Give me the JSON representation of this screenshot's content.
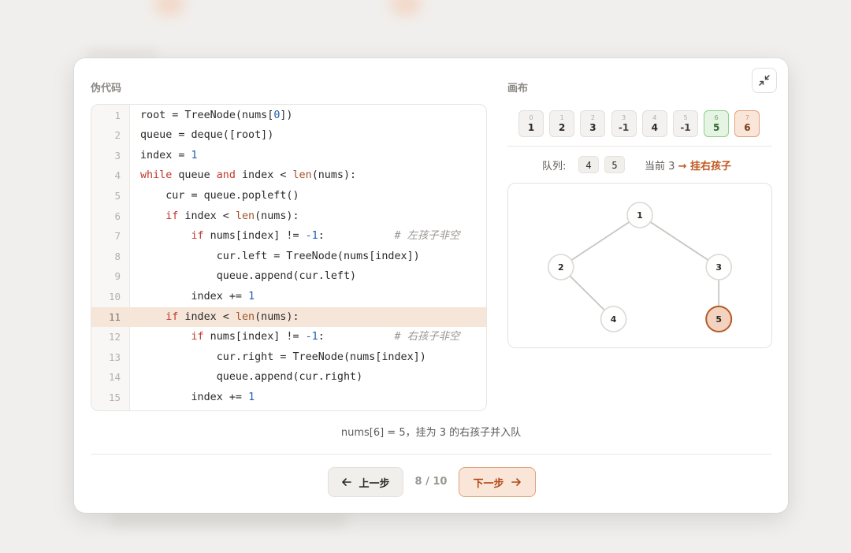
{
  "pseudocode_title": "伪代码",
  "canvas_title": "画布",
  "code": {
    "active_line": 11,
    "lines": [
      {
        "n": "1",
        "tokens": [
          {
            "t": "root = TreeNode(nums["
          },
          {
            "t": "0",
            "c": "num"
          },
          {
            "t": "])"
          }
        ]
      },
      {
        "n": "2",
        "tokens": [
          {
            "t": "queue = deque([root])"
          }
        ]
      },
      {
        "n": "3",
        "tokens": [
          {
            "t": "index = "
          },
          {
            "t": "1",
            "c": "num"
          }
        ]
      },
      {
        "n": "4",
        "tokens": [
          {
            "t": "while",
            "c": "kw"
          },
          {
            "t": " queue "
          },
          {
            "t": "and",
            "c": "kw"
          },
          {
            "t": " index < "
          },
          {
            "t": "len",
            "c": "bi"
          },
          {
            "t": "(nums):"
          }
        ]
      },
      {
        "n": "5",
        "tokens": [
          {
            "t": "    cur = queue.popleft()"
          }
        ]
      },
      {
        "n": "6",
        "tokens": [
          {
            "t": "    "
          },
          {
            "t": "if",
            "c": "kw"
          },
          {
            "t": " index < "
          },
          {
            "t": "len",
            "c": "bi"
          },
          {
            "t": "(nums):"
          }
        ]
      },
      {
        "n": "7",
        "tokens": [
          {
            "t": "        "
          },
          {
            "t": "if",
            "c": "kw"
          },
          {
            "t": " nums[index] != "
          },
          {
            "t": "-1",
            "c": "num"
          },
          {
            "t": ":           "
          },
          {
            "t": "# 左孩子非空",
            "c": "cm"
          }
        ]
      },
      {
        "n": "8",
        "tokens": [
          {
            "t": "            cur.left = TreeNode(nums[index])"
          }
        ]
      },
      {
        "n": "9",
        "tokens": [
          {
            "t": "            queue.append(cur.left)"
          }
        ]
      },
      {
        "n": "10",
        "tokens": [
          {
            "t": "        index += "
          },
          {
            "t": "1",
            "c": "num"
          }
        ]
      },
      {
        "n": "11",
        "tokens": [
          {
            "t": "    "
          },
          {
            "t": "if",
            "c": "kw"
          },
          {
            "t": " index < "
          },
          {
            "t": "len",
            "c": "bi"
          },
          {
            "t": "(nums):"
          }
        ]
      },
      {
        "n": "12",
        "tokens": [
          {
            "t": "        "
          },
          {
            "t": "if",
            "c": "kw"
          },
          {
            "t": " nums[index] != "
          },
          {
            "t": "-1",
            "c": "num"
          },
          {
            "t": ":           "
          },
          {
            "t": "# 右孩子非空",
            "c": "cm"
          }
        ]
      },
      {
        "n": "13",
        "tokens": [
          {
            "t": "            cur.right = TreeNode(nums[index])"
          }
        ]
      },
      {
        "n": "14",
        "tokens": [
          {
            "t": "            queue.append(cur.right)"
          }
        ]
      },
      {
        "n": "15",
        "tokens": [
          {
            "t": "        index += "
          },
          {
            "t": "1",
            "c": "num"
          }
        ]
      }
    ]
  },
  "array": [
    {
      "idx": "0",
      "val": "1",
      "state": "done"
    },
    {
      "idx": "1",
      "val": "2",
      "state": "done"
    },
    {
      "idx": "2",
      "val": "3",
      "state": "done"
    },
    {
      "idx": "3",
      "val": "-1",
      "state": "faded"
    },
    {
      "idx": "4",
      "val": "4",
      "state": "done"
    },
    {
      "idx": "5",
      "val": "-1",
      "state": "faded"
    },
    {
      "idx": "6",
      "val": "5",
      "state": "green"
    },
    {
      "idx": "7",
      "val": "6",
      "state": "orange"
    }
  ],
  "queue": {
    "label": "队列:",
    "items": [
      "4",
      "5"
    ],
    "current_label": "当前",
    "current_value": "3",
    "action": "→ 挂右孩子"
  },
  "tree": {
    "nodes": [
      {
        "id": "n1",
        "label": "1",
        "level": 0,
        "slot": 0,
        "highlight": false
      },
      {
        "id": "n2",
        "label": "2",
        "level": 1,
        "slot": 0,
        "highlight": false
      },
      {
        "id": "n3",
        "label": "3",
        "level": 1,
        "slot": 1,
        "highlight": false
      },
      {
        "id": "n4",
        "label": "4",
        "level": 2,
        "slot": 1,
        "highlight": false
      },
      {
        "id": "n5",
        "label": "5",
        "level": 2,
        "slot": 3,
        "highlight": true
      }
    ],
    "edges": [
      [
        "n1",
        "n2"
      ],
      [
        "n1",
        "n3"
      ],
      [
        "n2",
        "n4"
      ],
      [
        "n3",
        "n5"
      ]
    ]
  },
  "status": "nums[6] = 5，挂为 3 的右孩子并入队",
  "nav": {
    "prev_label": "上一步",
    "next_label": "下一步",
    "page": "8 / 10"
  },
  "colors": {
    "accent": "#c0551e",
    "highlight_line": "#f6e6da",
    "node_highlight": "#f3d3bf"
  },
  "icons": [
    "collapse-icon",
    "arrow-left-icon",
    "arrow-right-icon"
  ]
}
